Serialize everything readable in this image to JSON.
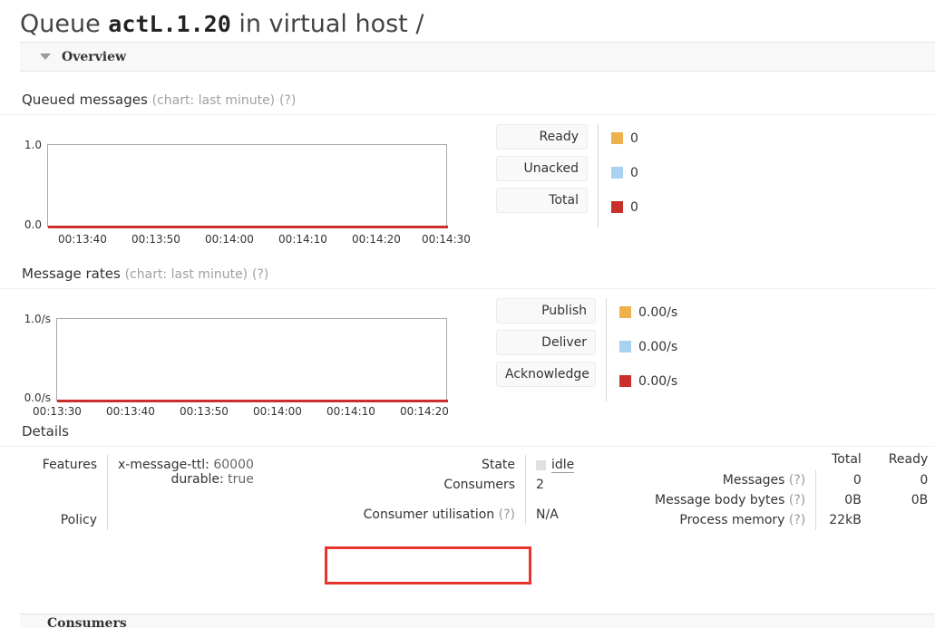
{
  "page": {
    "title_prefix": "Queue ",
    "queue_name": "actL.1.20",
    "title_suffix": " in virtual host /"
  },
  "overview_section": {
    "label": "Overview",
    "collapse_icon": "triangle-down-icon"
  },
  "queued_messages": {
    "heading": "Queued messages",
    "heading_note": "(chart: last minute)",
    "help": "(?)",
    "legend": [
      {
        "label": "Ready",
        "value": "0",
        "color": "#edb24c"
      },
      {
        "label": "Unacked",
        "value": "0",
        "color": "#a8d2f0"
      },
      {
        "label": "Total",
        "value": "0",
        "color": "#c9302c"
      }
    ]
  },
  "message_rates": {
    "heading": "Message rates",
    "heading_note": "(chart: last minute)",
    "help": "(?)",
    "legend": [
      {
        "label": "Publish",
        "value": "0.00/s",
        "color": "#edb24c"
      },
      {
        "label": "Deliver",
        "value": "0.00/s",
        "color": "#a8d2f0"
      },
      {
        "label": "Acknowledge",
        "value": "0.00/s",
        "color": "#c9302c"
      }
    ]
  },
  "details": {
    "heading": "Details",
    "features_key": "Features",
    "features": [
      {
        "name": "x-message-ttl:",
        "value": "60000"
      },
      {
        "name": "durable:",
        "value": "true"
      }
    ],
    "policy_key": "Policy",
    "policy_value": "",
    "state_key": "State",
    "state_value": "idle",
    "consumers_key": "Consumers",
    "consumers_value": "2",
    "consumer_util_key": "Consumer utilisation",
    "consumer_util_help": "(?)",
    "consumer_util_value": "N/A",
    "stats_col_total": "Total",
    "stats_col_ready": "Ready",
    "stats_rows": [
      {
        "label": "Messages",
        "help": "(?)",
        "total": "0",
        "ready": "0"
      },
      {
        "label": "Message body bytes",
        "help": "(?)",
        "total": "0B",
        "ready": "0B"
      },
      {
        "label": "Process memory",
        "help": "(?)",
        "total": "22kB",
        "ready": ""
      }
    ]
  },
  "bottom_section": {
    "label": "Consumers"
  },
  "chart_data": [
    {
      "type": "line",
      "title": "Queued messages",
      "subtitle": "(chart: last minute)",
      "xlabel": "",
      "ylabel": "",
      "ylim": [
        0.0,
        1.0
      ],
      "ytick_labels": [
        "1.0",
        "0.0"
      ],
      "xtick_labels": [
        "00:13:40",
        "00:13:50",
        "00:14:00",
        "00:14:10",
        "00:14:20",
        "00:14:30"
      ],
      "grid": false,
      "legend_position": "right",
      "series": [
        {
          "name": "Ready",
          "color": "#edb24c",
          "values": [
            0,
            0,
            0,
            0,
            0,
            0
          ]
        },
        {
          "name": "Unacked",
          "color": "#a8d2f0",
          "values": [
            0,
            0,
            0,
            0,
            0,
            0
          ]
        },
        {
          "name": "Total",
          "color": "#c9302c",
          "values": [
            0,
            0,
            0,
            0,
            0,
            0
          ]
        }
      ]
    },
    {
      "type": "line",
      "title": "Message rates",
      "subtitle": "(chart: last minute)",
      "xlabel": "",
      "ylabel": "",
      "ylim": [
        0.0,
        1.0
      ],
      "ytick_labels": [
        "1.0/s",
        "0.0/s"
      ],
      "xtick_labels": [
        "00:13:30",
        "00:13:40",
        "00:13:50",
        "00:14:00",
        "00:14:10",
        "00:14:20"
      ],
      "grid": false,
      "legend_position": "right",
      "series": [
        {
          "name": "Publish",
          "color": "#edb24c",
          "values": [
            0,
            0,
            0,
            0,
            0,
            0
          ]
        },
        {
          "name": "Deliver",
          "color": "#a8d2f0",
          "values": [
            0,
            0,
            0,
            0,
            0,
            0
          ]
        },
        {
          "name": "Acknowledge",
          "color": "#c9302c",
          "values": [
            0,
            0,
            0,
            0,
            0,
            0
          ]
        }
      ]
    }
  ]
}
